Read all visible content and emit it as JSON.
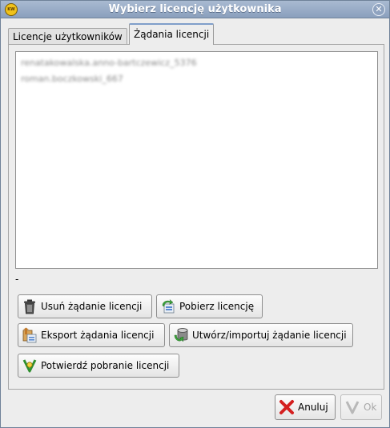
{
  "window": {
    "title": "Wybierz licencję użytkownika"
  },
  "tabs": [
    {
      "label": "Licencje użytkowników",
      "active": false
    },
    {
      "label": "Żądania licencji",
      "active": true
    }
  ],
  "requests": {
    "items": [
      "renatakowalska.anno-bartczewicz_5376",
      "roman.boczkowski_667"
    ],
    "status": "-"
  },
  "actions": {
    "delete_request": "Usuń żądanie licencji",
    "download_license": "Pobierz licencję",
    "export_request": "Eksport żądania licencji",
    "create_import_request": "Utwórz/importuj żądanie licencji",
    "confirm_download": "Potwierdź pobranie licencji"
  },
  "footer": {
    "cancel": "Anuluj",
    "ok": "Ok"
  },
  "icons": {
    "app": "kw-logo-icon",
    "close": "close-icon",
    "delete": "trash-icon",
    "download": "download-license-icon",
    "export": "export-icon",
    "create": "database-import-icon",
    "confirm": "confirm-icon",
    "cancel": "red-x-icon",
    "ok": "check-icon"
  }
}
